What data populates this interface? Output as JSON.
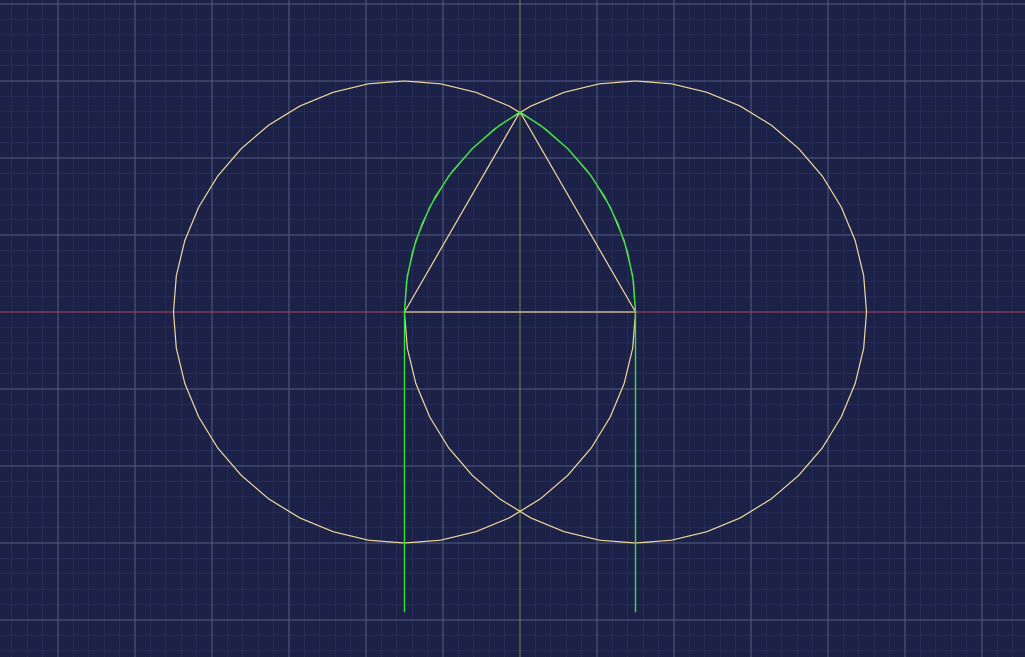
{
  "colors": {
    "background": "#1b2147",
    "minor_grid": "#2b3563",
    "major_grid": "#555d84",
    "x_axis": "#b54260",
    "y_axis": "#6f8d3a",
    "construction": "#f2d79b",
    "arch": "#35e43a"
  },
  "drawing": {
    "grid_visible": true,
    "units_per_major_cell": 1,
    "minor_divisions_per_major": 5,
    "circles": [
      {
        "name": "left-circle",
        "center": [
          -1.5,
          0
        ],
        "radius": 3.0,
        "segments": 40
      },
      {
        "name": "right-circle",
        "center": [
          1.5,
          0
        ],
        "radius": 3.0,
        "segments": 40
      }
    ],
    "triangle": [
      [
        -1.5,
        0
      ],
      [
        1.5,
        0
      ],
      [
        0,
        2.6
      ]
    ],
    "arch": {
      "left_arc": {
        "center": [
          1.5,
          0
        ],
        "radius": 3.0,
        "from_deg": 180,
        "to_deg": 120,
        "segments": 8
      },
      "right_arc": {
        "center": [
          -1.5,
          0
        ],
        "radius": 3.0,
        "from_deg": 60,
        "to_deg": 0,
        "segments": 8
      },
      "jambs": [
        {
          "name": "left-jamb",
          "x": -1.5,
          "y_from": 0,
          "y_to": -3.9
        },
        {
          "name": "right-jamb",
          "x": 1.5,
          "y_from": 0,
          "y_to": -3.9
        }
      ]
    }
  }
}
